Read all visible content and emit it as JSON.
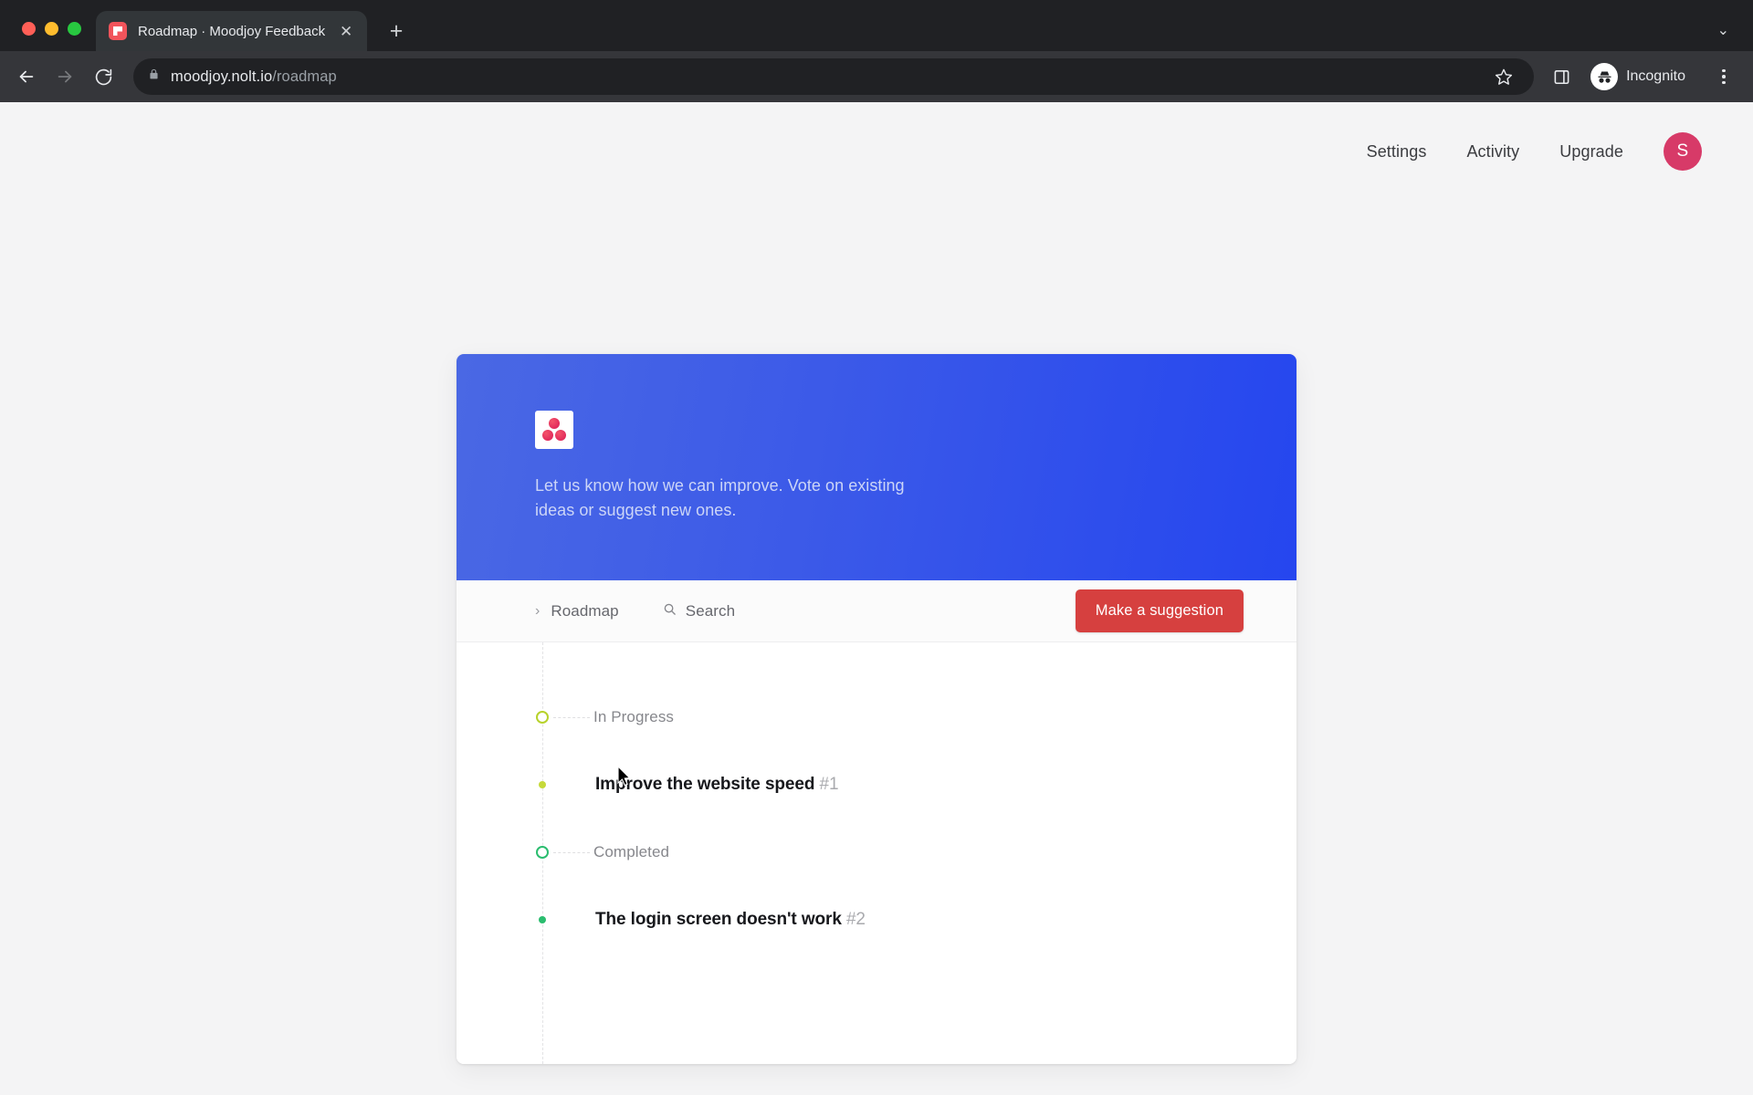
{
  "browser": {
    "tab": {
      "title": "Roadmap · Moodjoy Feedback",
      "favicon_name": "moodjoy-favicon",
      "close_glyph": "✕"
    },
    "new_tab_glyph": "+",
    "tablist_chevron_glyph": "⌄",
    "address": {
      "domain": "moodjoy.nolt.io",
      "path": "/roadmap",
      "lock_icon": "lock-icon"
    },
    "profile": {
      "label": "Incognito",
      "icon": "incognito-icon"
    },
    "buttons": {
      "back": "back-arrow-icon",
      "forward": "forward-arrow-icon",
      "reload": "reload-icon",
      "bookmark": "star-icon",
      "side_panel": "side-panel-icon",
      "menu": "three-dot-menu-icon"
    }
  },
  "topnav": {
    "links": [
      {
        "label": "Settings"
      },
      {
        "label": "Activity"
      },
      {
        "label": "Upgrade"
      }
    ],
    "avatar": {
      "initial": "S",
      "color": "#d73a68"
    }
  },
  "card": {
    "hero": {
      "description": "Let us know how we can improve. Vote on existing ideas or suggest new ones.",
      "logo_name": "moodjoy-logo",
      "gradient_from": "#4a68e4",
      "gradient_to": "#2546ef"
    },
    "toolbar": {
      "breadcrumb_label": "Roadmap",
      "breadcrumb_chevron": "›",
      "search_label": "Search",
      "search_icon": "search-icon",
      "suggestion_button": "Make a suggestion",
      "suggestion_button_color": "#d6403f"
    },
    "roadmap": {
      "sections": [
        {
          "label": "In Progress",
          "color": "#b7d22b",
          "items": [
            {
              "title": "Improve the website speed",
              "number": "#1",
              "dot_color": "#c6d93a"
            }
          ]
        },
        {
          "label": "Completed",
          "color": "#2bbd6f",
          "items": [
            {
              "title": "The login screen doesn't work",
              "number": "#2",
              "dot_color": "#2bbd6f"
            }
          ]
        }
      ]
    }
  }
}
